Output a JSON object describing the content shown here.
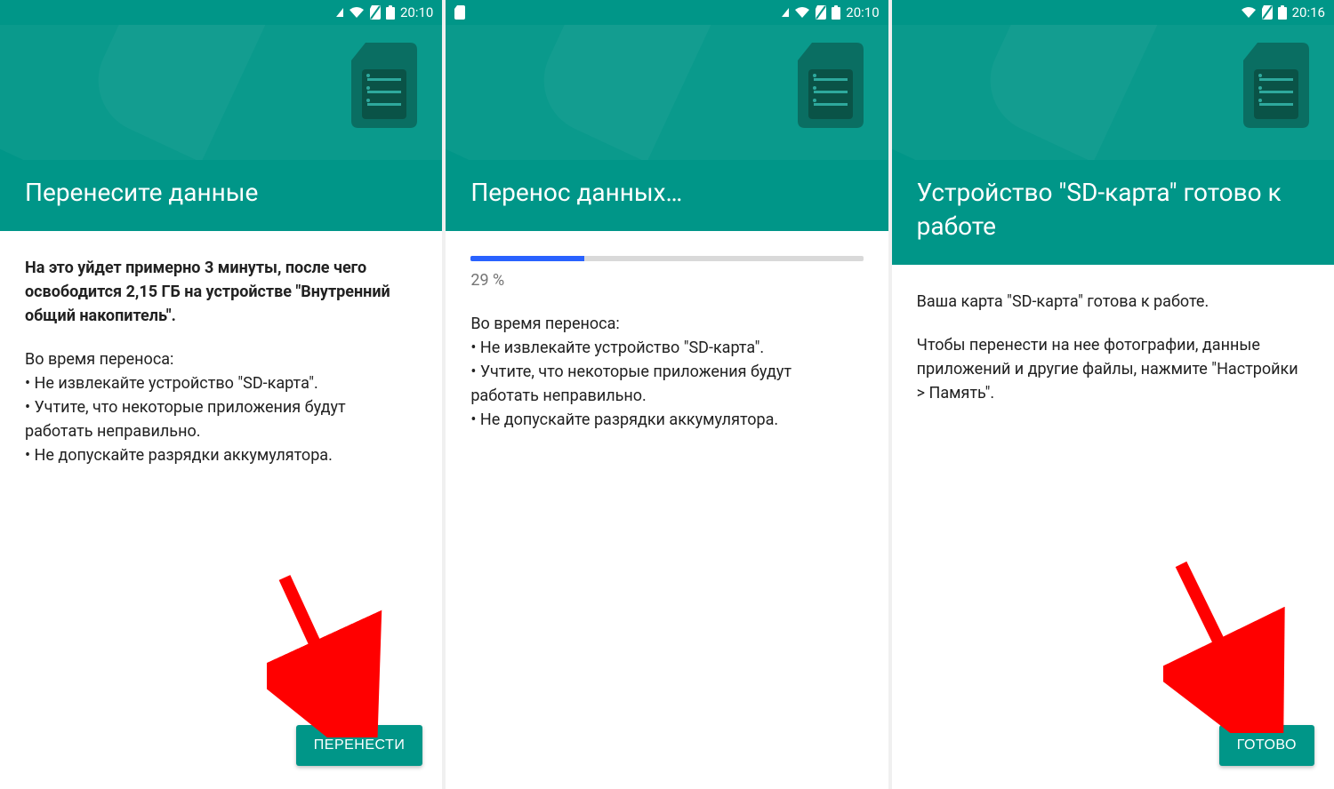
{
  "screens": [
    {
      "status": {
        "time": "20:10",
        "left_sd_icon": false
      },
      "title": "Перенесите данные",
      "bold_line": "На это уйдет примерно 3 минуты, после чего освободится 2,15 ГБ на устройстве \"Внутренний общий накопитель\".",
      "intro": "Во время переноса:",
      "bullets": [
        "Не извлекайте устройство \"SD-карта\".",
        "Учтите, что некоторые приложения будут работать неправильно.",
        "Не допускайте разрядки аккумулятора."
      ],
      "button": "ПЕРЕНЕСТИ",
      "has_button": true,
      "has_arrow": true
    },
    {
      "status": {
        "time": "20:10",
        "left_sd_icon": true
      },
      "title": "Перенос данных…",
      "progress_pct": 29,
      "progress_label": "29 %",
      "intro": "Во время переноса:",
      "bullets": [
        "Не извлекайте устройство \"SD-карта\".",
        "Учтите, что некоторые приложения будут работать неправильно.",
        "Не допускайте разрядки аккумулятора."
      ],
      "has_button": false,
      "has_arrow": false
    },
    {
      "status": {
        "time": "20:16",
        "left_sd_icon": false
      },
      "title": "Устройство \"SD-карта\" готово к работе",
      "paras": [
        "Ваша карта \"SD-карта\" готова к работе.",
        "Чтобы перенести на нее фотографии, данные приложений и другие файлы, нажмите \"Настройки > Память\"."
      ],
      "button": "ГОТОВО",
      "has_button": true,
      "has_arrow": true
    }
  ]
}
